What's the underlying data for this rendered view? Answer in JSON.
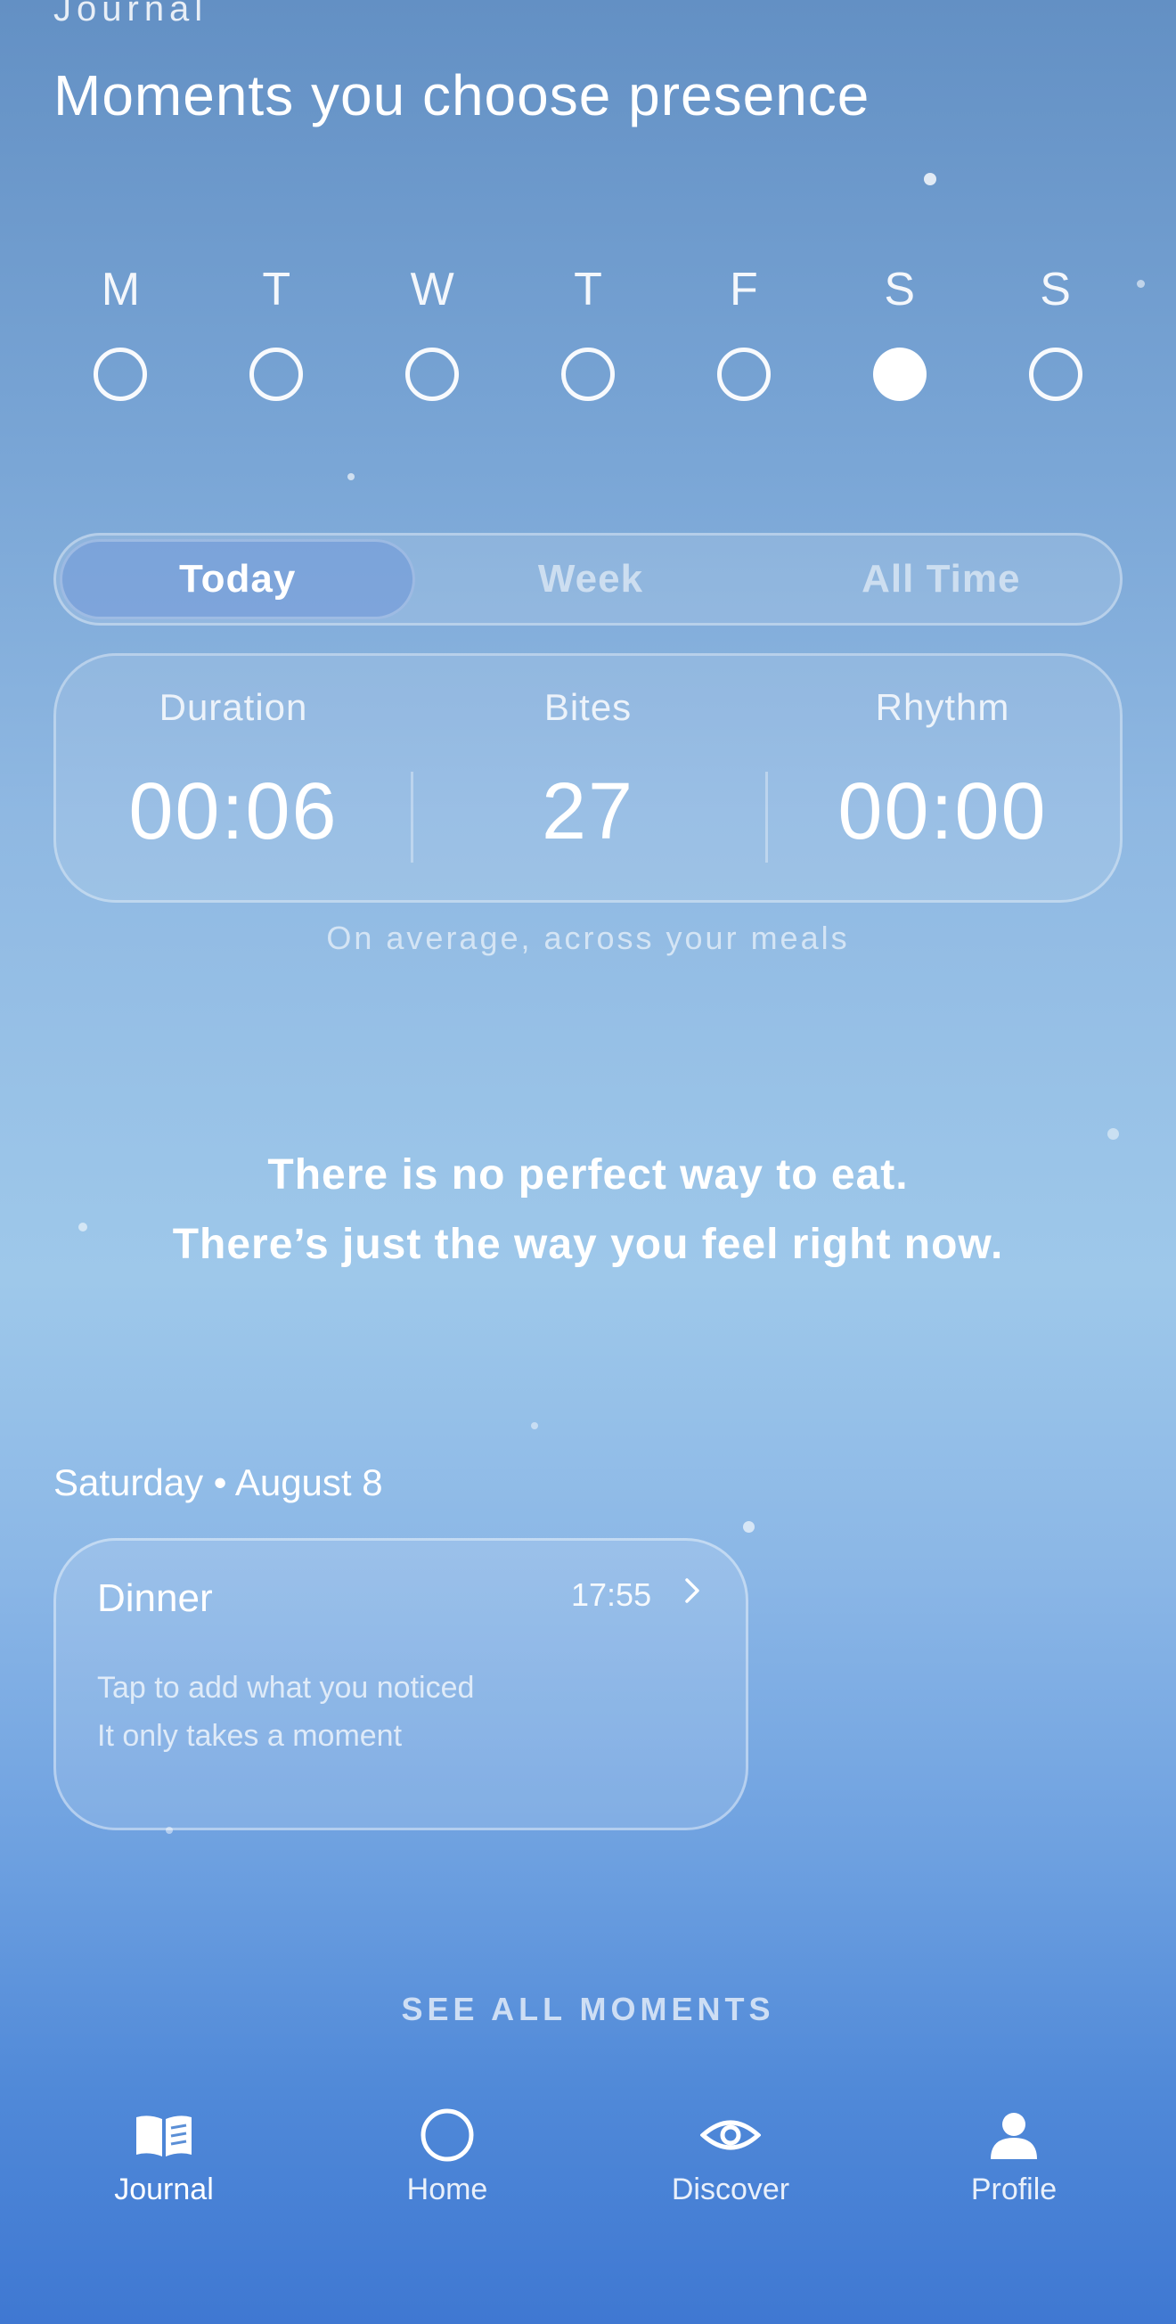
{
  "header": {
    "eyebrow": "Journal",
    "title": "Moments you choose presence"
  },
  "week": {
    "days": [
      {
        "letter": "M",
        "done": false
      },
      {
        "letter": "T",
        "done": false
      },
      {
        "letter": "W",
        "done": false
      },
      {
        "letter": "T",
        "done": false
      },
      {
        "letter": "F",
        "done": false
      },
      {
        "letter": "S",
        "done": true
      },
      {
        "letter": "S",
        "done": false
      }
    ]
  },
  "range": {
    "options": [
      "Today",
      "Week",
      "All Time"
    ],
    "selected": "Today"
  },
  "stats": {
    "duration_label": "Duration",
    "duration_value": "00:06",
    "bites_label": "Bites",
    "bites_value": "27",
    "rhythm_label": "Rhythm",
    "rhythm_value": "00:00",
    "note": "On average, across your meals"
  },
  "quote": {
    "line1": "There is no perfect way to eat.",
    "line2": "There’s just the way you feel right now."
  },
  "moments": {
    "date_heading": "Saturday • August 8",
    "meal": {
      "title": "Dinner",
      "time": "17:55",
      "hint_line1": "Tap to add what you noticed",
      "hint_line2": "It only takes a moment"
    },
    "see_all": "SEE ALL MOMENTS"
  },
  "nav": {
    "journal": "Journal",
    "home": "Home",
    "discover": "Discover",
    "profile": "Profile"
  },
  "colors": {
    "text": "#ffffff",
    "bg_top": "#6390c4",
    "bg_bottom": "#3f78d2"
  }
}
